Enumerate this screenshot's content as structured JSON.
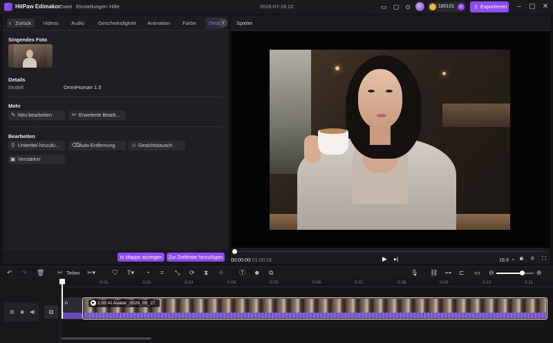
{
  "app": {
    "name": "HitPaw Edimakor",
    "menu": [
      "Datei",
      "Einstellungen",
      "Hilfe"
    ],
    "document_title": "2026-07-28 02",
    "credits": "180101",
    "export_label": "Exportieren"
  },
  "left_panel": {
    "back_label": "Zurück",
    "tabs": [
      "Videos",
      "Audio",
      "Geschwindigkeit",
      "Animation",
      "Farbe",
      "Deta"
    ],
    "single_photo_title": "Singendes Foto",
    "details": {
      "title": "Details",
      "model_label": "Modell",
      "model_value": "OmniHuman 1.5"
    },
    "more": {
      "title": "Mehr",
      "buttons": [
        "Neu bearbeiten",
        "Erweiterte Bearb..."
      ]
    },
    "edit": {
      "title": "Bearbeiten",
      "buttons": [
        "Untertitel hinzufü...",
        "Auto-Entfernung",
        "Gesichtstausch",
        "Verstärker"
      ]
    },
    "footer": {
      "show_in_folder": "In Mappe anzeigen",
      "add_to_timeline": "Zur Zeitleiste hinzufügen"
    }
  },
  "player": {
    "label": "Spieler",
    "time_current": "00:00:00",
    "time_total": "/ 01:00:16",
    "aspect": "16:9",
    "progress": 0
  },
  "timeline": {
    "split_label": "Teilen",
    "ruler_labels": [
      "0:01",
      "0:02",
      "0:03",
      "0:04",
      "0:05",
      "0:06",
      "0:07",
      "0:08",
      "0:09",
      "0:10",
      "0:11"
    ],
    "ghost_clip_label": "0",
    "clip_label": "1:00 AI Avatar_2026_05_27",
    "zoom_level": 0.68
  },
  "colors": {
    "accent": "#8f4bff",
    "background": "#141416",
    "panel": "#1f1f23"
  },
  "icons": [
    "logo-icon",
    "layout-icon",
    "feedback-icon",
    "download-icon",
    "avatar-icon",
    "coin-icon",
    "export-icon",
    "minimize-icon",
    "maximize-icon",
    "close-icon",
    "undo-icon",
    "redo-icon",
    "delete-icon",
    "scissors-icon",
    "play-icon",
    "zoom-icon"
  ]
}
